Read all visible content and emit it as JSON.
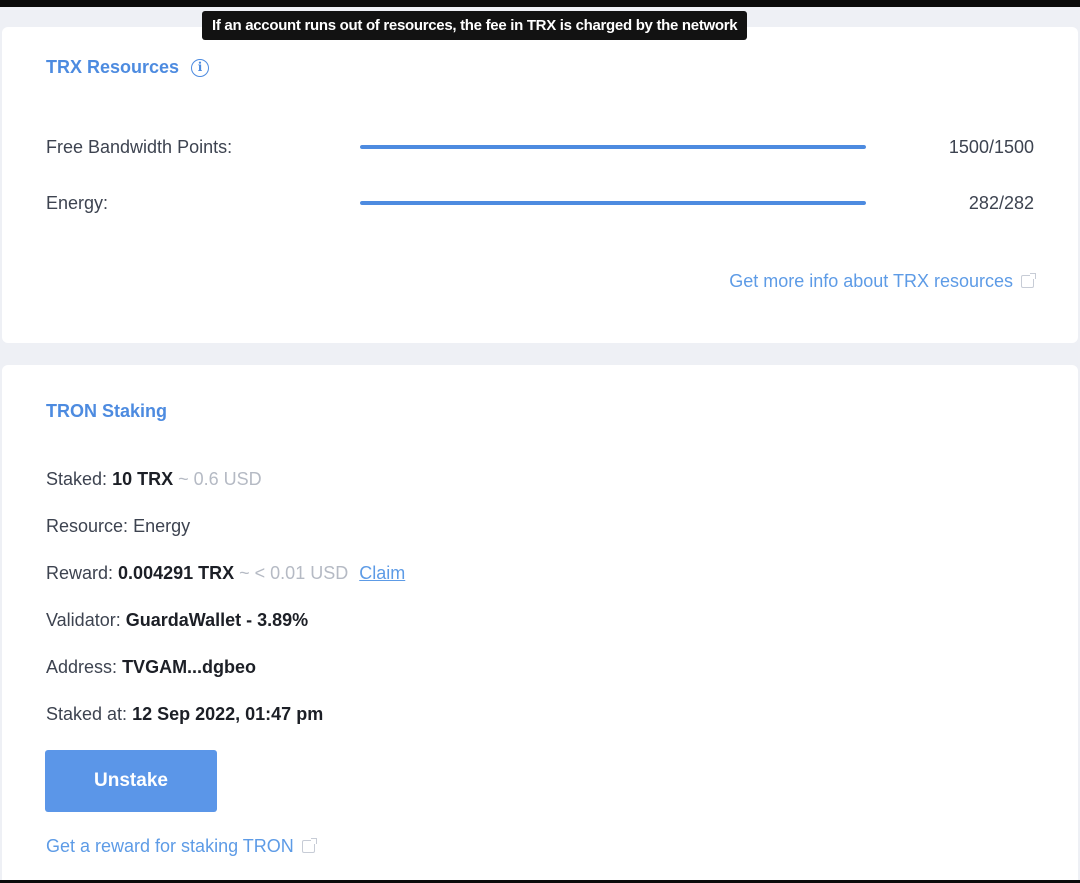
{
  "tooltip": "If an account runs out of resources, the fee in TRX is charged by the network",
  "resources": {
    "title": "TRX Resources",
    "info_icon": "info-icon",
    "rows": [
      {
        "label": "Free Bandwidth Points:",
        "value": "1500/1500",
        "fill_fraction": 1.0
      },
      {
        "label": "Energy:",
        "value": "282/282",
        "fill_fraction": 1.0
      }
    ],
    "more_info_link": "Get more info about TRX resources",
    "link_icon": "external-link-icon"
  },
  "staking": {
    "title": "TRON Staking",
    "staked": {
      "label": "Staked:",
      "amount": "10 TRX",
      "approx": "~ 0.6 USD"
    },
    "resource": {
      "label": "Resource:",
      "value": "Energy"
    },
    "reward": {
      "label": "Reward:",
      "amount": "0.004291 TRX",
      "approx": "~ < 0.01 USD",
      "claim": "Claim"
    },
    "validator": {
      "label": "Validator:",
      "value": "GuardaWallet - 3.89%"
    },
    "address": {
      "label": "Address:",
      "value": "TVGAM...dgbeo"
    },
    "staked_at": {
      "label": "Staked at:",
      "value": "12 Sep 2022, 01:47 pm"
    },
    "unstake_button": "Unstake",
    "reward_link": "Get a reward for staking TRON"
  },
  "colors": {
    "accent": "#4d8be0",
    "button": "#5b96e8",
    "muted": "#b5bac4"
  }
}
